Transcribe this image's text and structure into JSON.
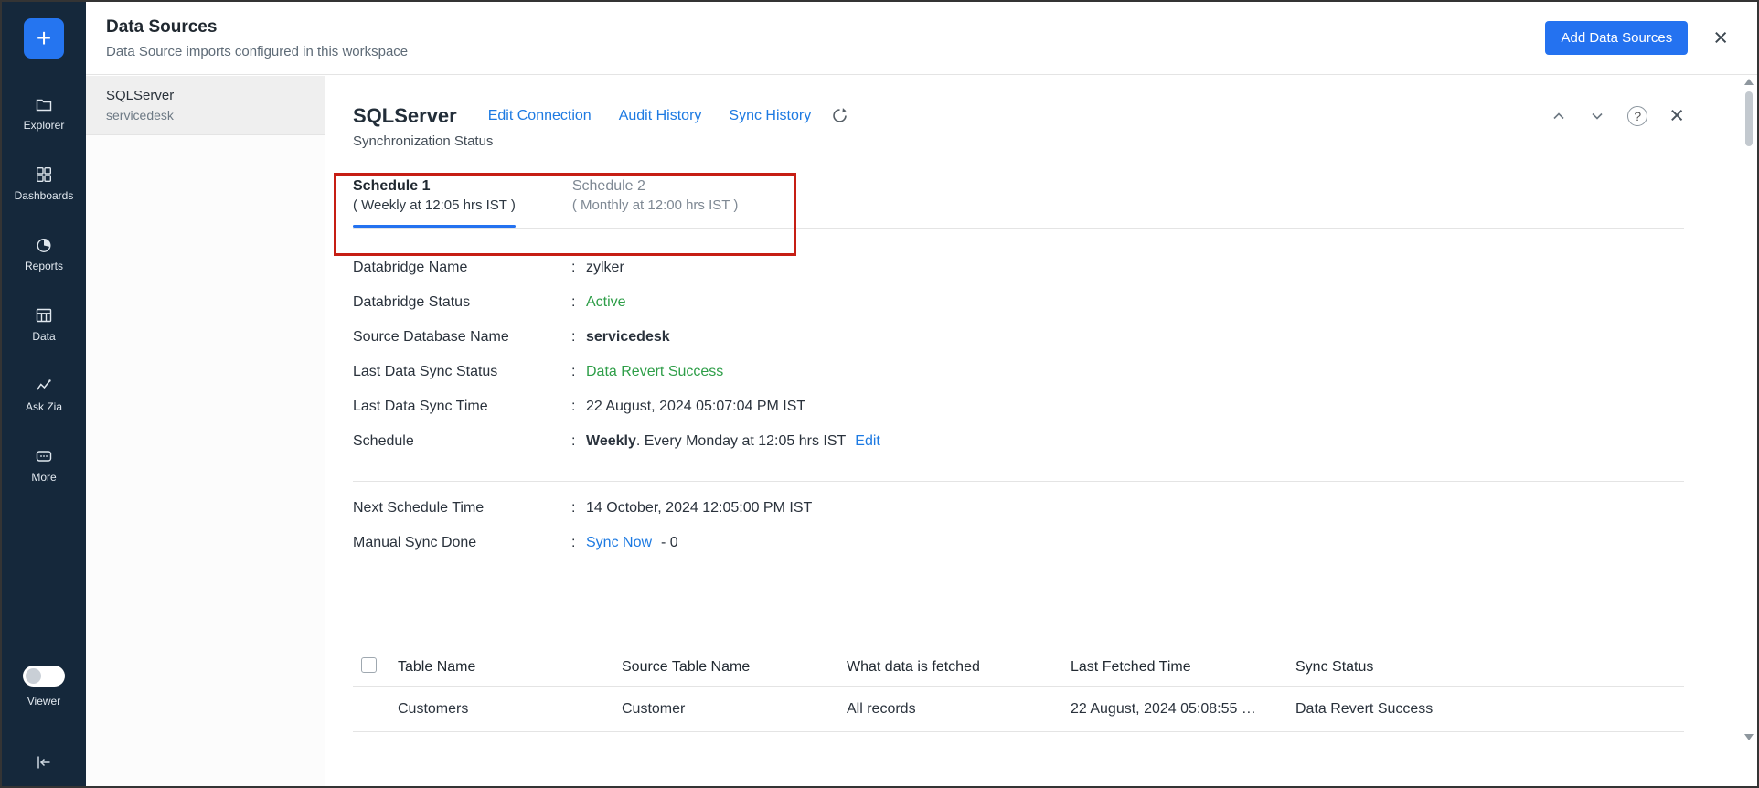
{
  "ui": {
    "colon": ":",
    "plus": "+",
    "close": "×",
    "help": "?"
  },
  "colors": {
    "accent_blue": "#2472F0",
    "link_blue": "#1D7AE2",
    "success_green": "#2E9E48",
    "annotation_red": "#C61E14",
    "sidebar_bg": "#15283B"
  },
  "sidebar": {
    "items": [
      {
        "label": "Explorer"
      },
      {
        "label": "Dashboards"
      },
      {
        "label": "Reports"
      },
      {
        "label": "Data"
      },
      {
        "label": "Ask Zia"
      },
      {
        "label": "More"
      }
    ],
    "viewer_label": "Viewer"
  },
  "header": {
    "title": "Data Sources",
    "subtitle": "Data Source imports configured in this workspace",
    "add_button_label": "Add Data Sources"
  },
  "source_list": {
    "selected": {
      "name": "SQLServer",
      "database": "servicedesk"
    }
  },
  "main": {
    "title": "SQLServer",
    "links": {
      "edit_connection": "Edit Connection",
      "audit_history": "Audit History",
      "sync_history": "Sync History"
    },
    "section_label": "Synchronization Status",
    "tabs": [
      {
        "title": "Schedule 1",
        "subtitle": "( Weekly at 12:05 hrs IST )"
      },
      {
        "title": "Schedule 2",
        "subtitle": "( Monthly at 12:00 hrs IST )"
      }
    ],
    "details": {
      "rows": [
        {
          "label": "Databridge Name",
          "value": "zylker"
        },
        {
          "label": "Databridge Status",
          "value": "Active"
        },
        {
          "label": "Source Database Name",
          "value": "servicedesk"
        },
        {
          "label": "Last Data Sync Status",
          "value": "Data Revert Success"
        },
        {
          "label": "Last Data Sync Time",
          "value": "22 August, 2024 05:07:04 PM IST"
        }
      ],
      "schedule": {
        "label": "Schedule",
        "frequency": "Weekly",
        "rest": ". Every Monday at 12:05 hrs IST",
        "edit_link": "Edit"
      },
      "next_schedule": {
        "label": "Next Schedule Time",
        "value": "14 October, 2024 12:05:00 PM IST"
      },
      "manual_sync": {
        "label": "Manual Sync Done",
        "link": "Sync Now",
        "count": "- 0"
      }
    },
    "table": {
      "headers": {
        "table_name": "Table Name",
        "source_table_name": "Source Table Name",
        "what_data": "What data is fetched",
        "last_fetched": "Last Fetched Time",
        "sync_status": "Sync Status"
      },
      "rows": [
        {
          "table_name": "Customers",
          "source_table_name": "Customer",
          "what_data": "All records",
          "last_fetched": "22 August, 2024 05:08:55 …",
          "sync_status": "Data Revert Success"
        }
      ]
    }
  }
}
